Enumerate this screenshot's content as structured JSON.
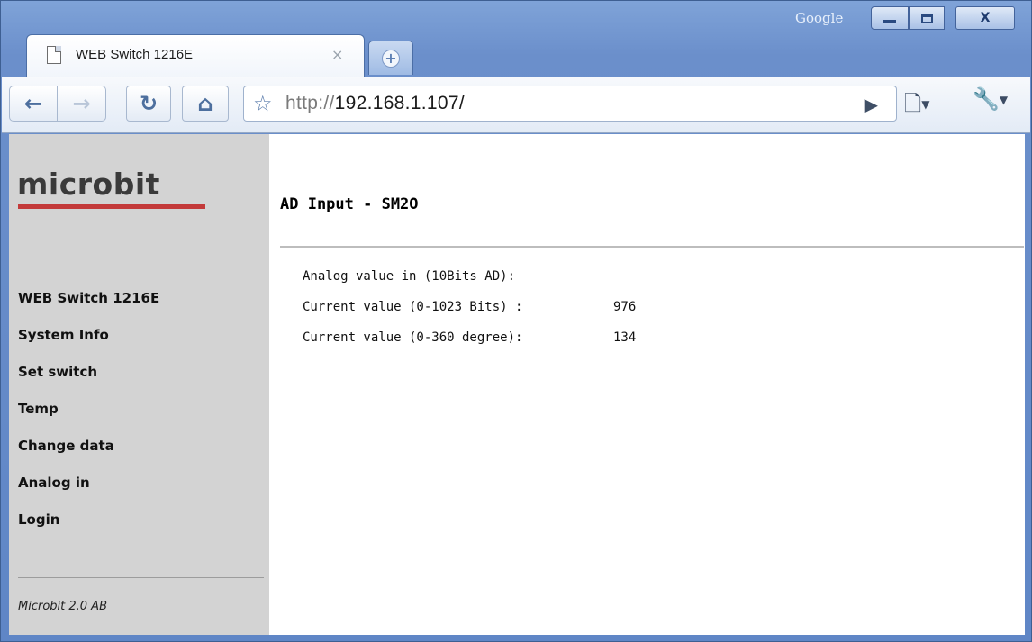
{
  "window": {
    "brand": "Google",
    "close_glyph": "X"
  },
  "tab": {
    "title": "WEB Switch 1216E",
    "close_glyph": "×",
    "new_tab_glyph": "+"
  },
  "toolbar": {
    "url_scheme": "http://",
    "url_host": "192.168.1.107/"
  },
  "sidebar": {
    "logo": "microbit",
    "items": [
      {
        "label": "WEB Switch 1216E"
      },
      {
        "label": "System Info"
      },
      {
        "label": "Set switch"
      },
      {
        "label": "Temp"
      },
      {
        "label": "Change data"
      },
      {
        "label": "Analog in"
      },
      {
        "label": "Login"
      }
    ],
    "footer": "Microbit 2.0 AB"
  },
  "main": {
    "title": "AD Input - SM2O",
    "heading_row": "Analog value in (10Bits AD):",
    "rows": [
      {
        "label": "Current value (0-1023 Bits) :",
        "value": "976"
      },
      {
        "label": "Current value (0-360 degree):",
        "value": "134"
      }
    ]
  }
}
